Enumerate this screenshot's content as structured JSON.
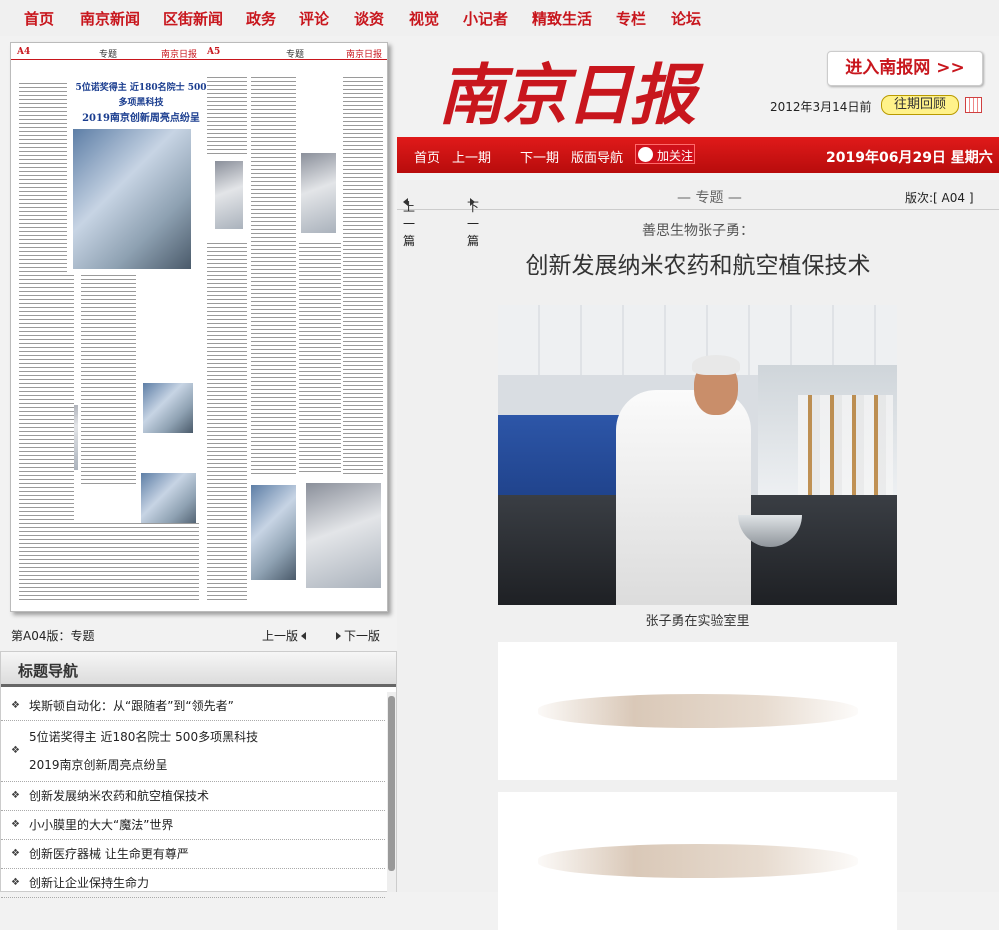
{
  "topnav": [
    "首页",
    "南京新闻",
    "区街新闻",
    "政务",
    "评论",
    "谈资",
    "视觉",
    "小记者",
    "精致生活",
    "专栏",
    "论坛"
  ],
  "thumb": {
    "left_header": "A4",
    "left_section": "专题",
    "right_header": "A5",
    "right_section": "专题",
    "masthead_small": "南京日报",
    "title_line1": "5位诺奖得主 近180名院士 500多项黑科技",
    "title_line2": "2019南京创新周亮点纷呈"
  },
  "page_info": "第A04版：专题",
  "prev_edition": "上一版",
  "next_edition": "下一版",
  "nav_title": "标题导航",
  "nav_items": [
    "埃斯顿自动化：从“跟随者”到“领先者”",
    "5位诺奖得主  近180名院士  500多项黑科技",
    "2019南京创新周亮点纷呈",
    "创新发展纳米农药和航空植保技术",
    "小小膜里的大大“魔法”世界",
    "创新医疗器械  让生命更有尊严",
    "创新让企业保持生命力"
  ],
  "header": {
    "logo": "南京日报",
    "enter_button": "进入南报网 >>",
    "date_before": "2012年3月14日前",
    "back_issues": "往期回顾"
  },
  "redbar": {
    "home": "首页",
    "prev_issue": "上一期",
    "next_issue": "下一期",
    "page_nav": "版面导航",
    "follow": "加关注",
    "current_date": "2019年06月29日 星期六"
  },
  "article": {
    "prev_article": "上一篇",
    "next_article": "下一篇",
    "section": "— 专题 —",
    "edition": "版次:[ A04 ]",
    "subtitle": "善思生物张子勇：",
    "headline": "创新发展纳米农药和航空植保技术",
    "caption": "张子勇在实验室里"
  },
  "colors": {
    "brand_red": "#c8161d",
    "bar_red": "#d71414"
  }
}
